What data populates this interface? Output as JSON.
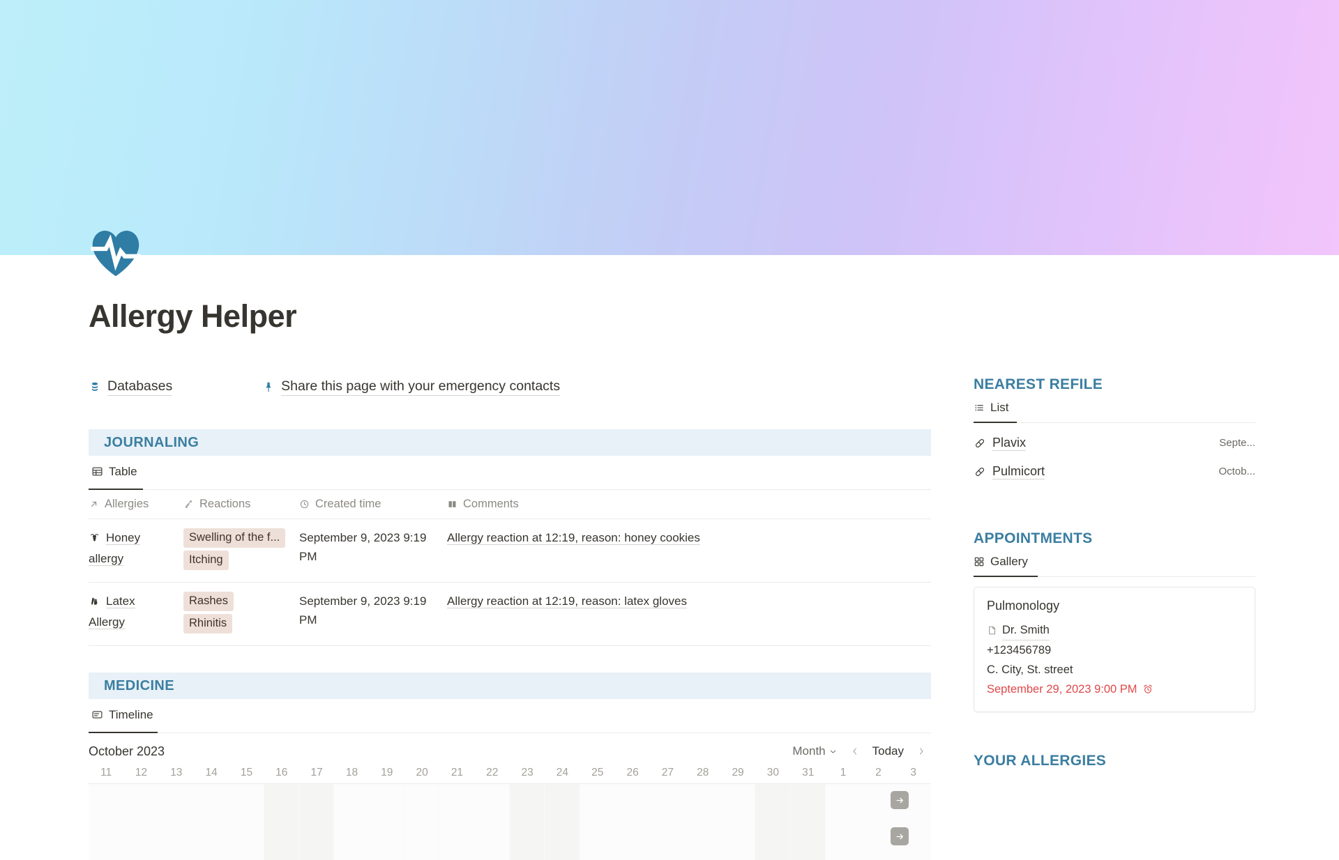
{
  "banner": {
    "gradient_from": "#bdeffa",
    "gradient_mid": "#c3cdf6",
    "gradient_to": "#f2c5fb"
  },
  "page": {
    "icon": "heart-pulse-icon",
    "icon_color": "#2f7da5",
    "title": "Allergy Helper"
  },
  "links": [
    {
      "icon": "database-icon",
      "label": "Databases"
    },
    {
      "icon": "pushpin-icon",
      "label": "Share this page with your emergency contacts"
    }
  ],
  "journaling": {
    "heading": "JOURNALING",
    "view_tab": {
      "icon": "table-icon",
      "label": "Table"
    },
    "columns": [
      {
        "icon": "arrow-up-right-icon",
        "label": "Allergies"
      },
      {
        "icon": "relation-arrows-icon",
        "label": "Reactions"
      },
      {
        "icon": "clock-icon",
        "label": "Created time"
      },
      {
        "icon": "book-icon",
        "label": "Comments"
      }
    ],
    "rows": [
      {
        "icon": "bee-icon",
        "allergy": "Honey allergy",
        "reactions": [
          "Swelling of the f...",
          "Itching"
        ],
        "created_time": "September 9, 2023 9:19 PM",
        "comment": "Allergy reaction at 12:19, reason: honey cookies"
      },
      {
        "icon": "glove-icon",
        "allergy": "Latex Allergy",
        "reactions": [
          "Rashes",
          "Rhinitis"
        ],
        "created_time": "September 9, 2023 9:19 PM",
        "comment": "Allergy reaction at 12:19, reason: latex gloves"
      }
    ]
  },
  "medicine": {
    "heading": "MEDICINE",
    "view_tab": {
      "icon": "timeline-icon",
      "label": "Timeline"
    },
    "timeline": {
      "month_label": "October 2023",
      "zoom_label": "Month",
      "today_label": "Today",
      "prev_icon": "chevron-left-icon",
      "next_icon": "chevron-right-icon",
      "zoom_caret_icon": "chevron-down-icon",
      "dates": [
        "11",
        "12",
        "13",
        "14",
        "15",
        "16",
        "17",
        "18",
        "19",
        "20",
        "21",
        "22",
        "23",
        "24",
        "25",
        "26",
        "27",
        "28",
        "29",
        "30",
        "31",
        "1",
        "2",
        "3"
      ],
      "weekend_indices": [
        3,
        4,
        10,
        11,
        17,
        18
      ],
      "add_buttons": [
        "arrow-right-icon",
        "arrow-right-icon"
      ]
    }
  },
  "sidebar": {
    "nearest_refile": {
      "heading": "NEAREST REFILE",
      "view_tab": {
        "icon": "list-icon",
        "label": "List"
      },
      "items": [
        {
          "icon": "pill-icon",
          "name": "Plavix",
          "date": "Septe..."
        },
        {
          "icon": "pill-icon",
          "name": "Pulmicort",
          "date": "Octob..."
        }
      ]
    },
    "appointments": {
      "heading": "APPOINTMENTS",
      "view_tab": {
        "icon": "gallery-icon",
        "label": "Gallery"
      },
      "card": {
        "title": "Pulmonology",
        "doctor_icon": "document-icon",
        "doctor": "Dr. Smith",
        "phone": "+123456789",
        "address": "C. City, St. street",
        "datetime": "September 29, 2023 9:00 PM",
        "datetime_color": "#e0484a",
        "alarm_icon": "alarm-clock-icon"
      }
    },
    "your_allergies": {
      "heading": "YOUR ALLERGIES"
    }
  }
}
